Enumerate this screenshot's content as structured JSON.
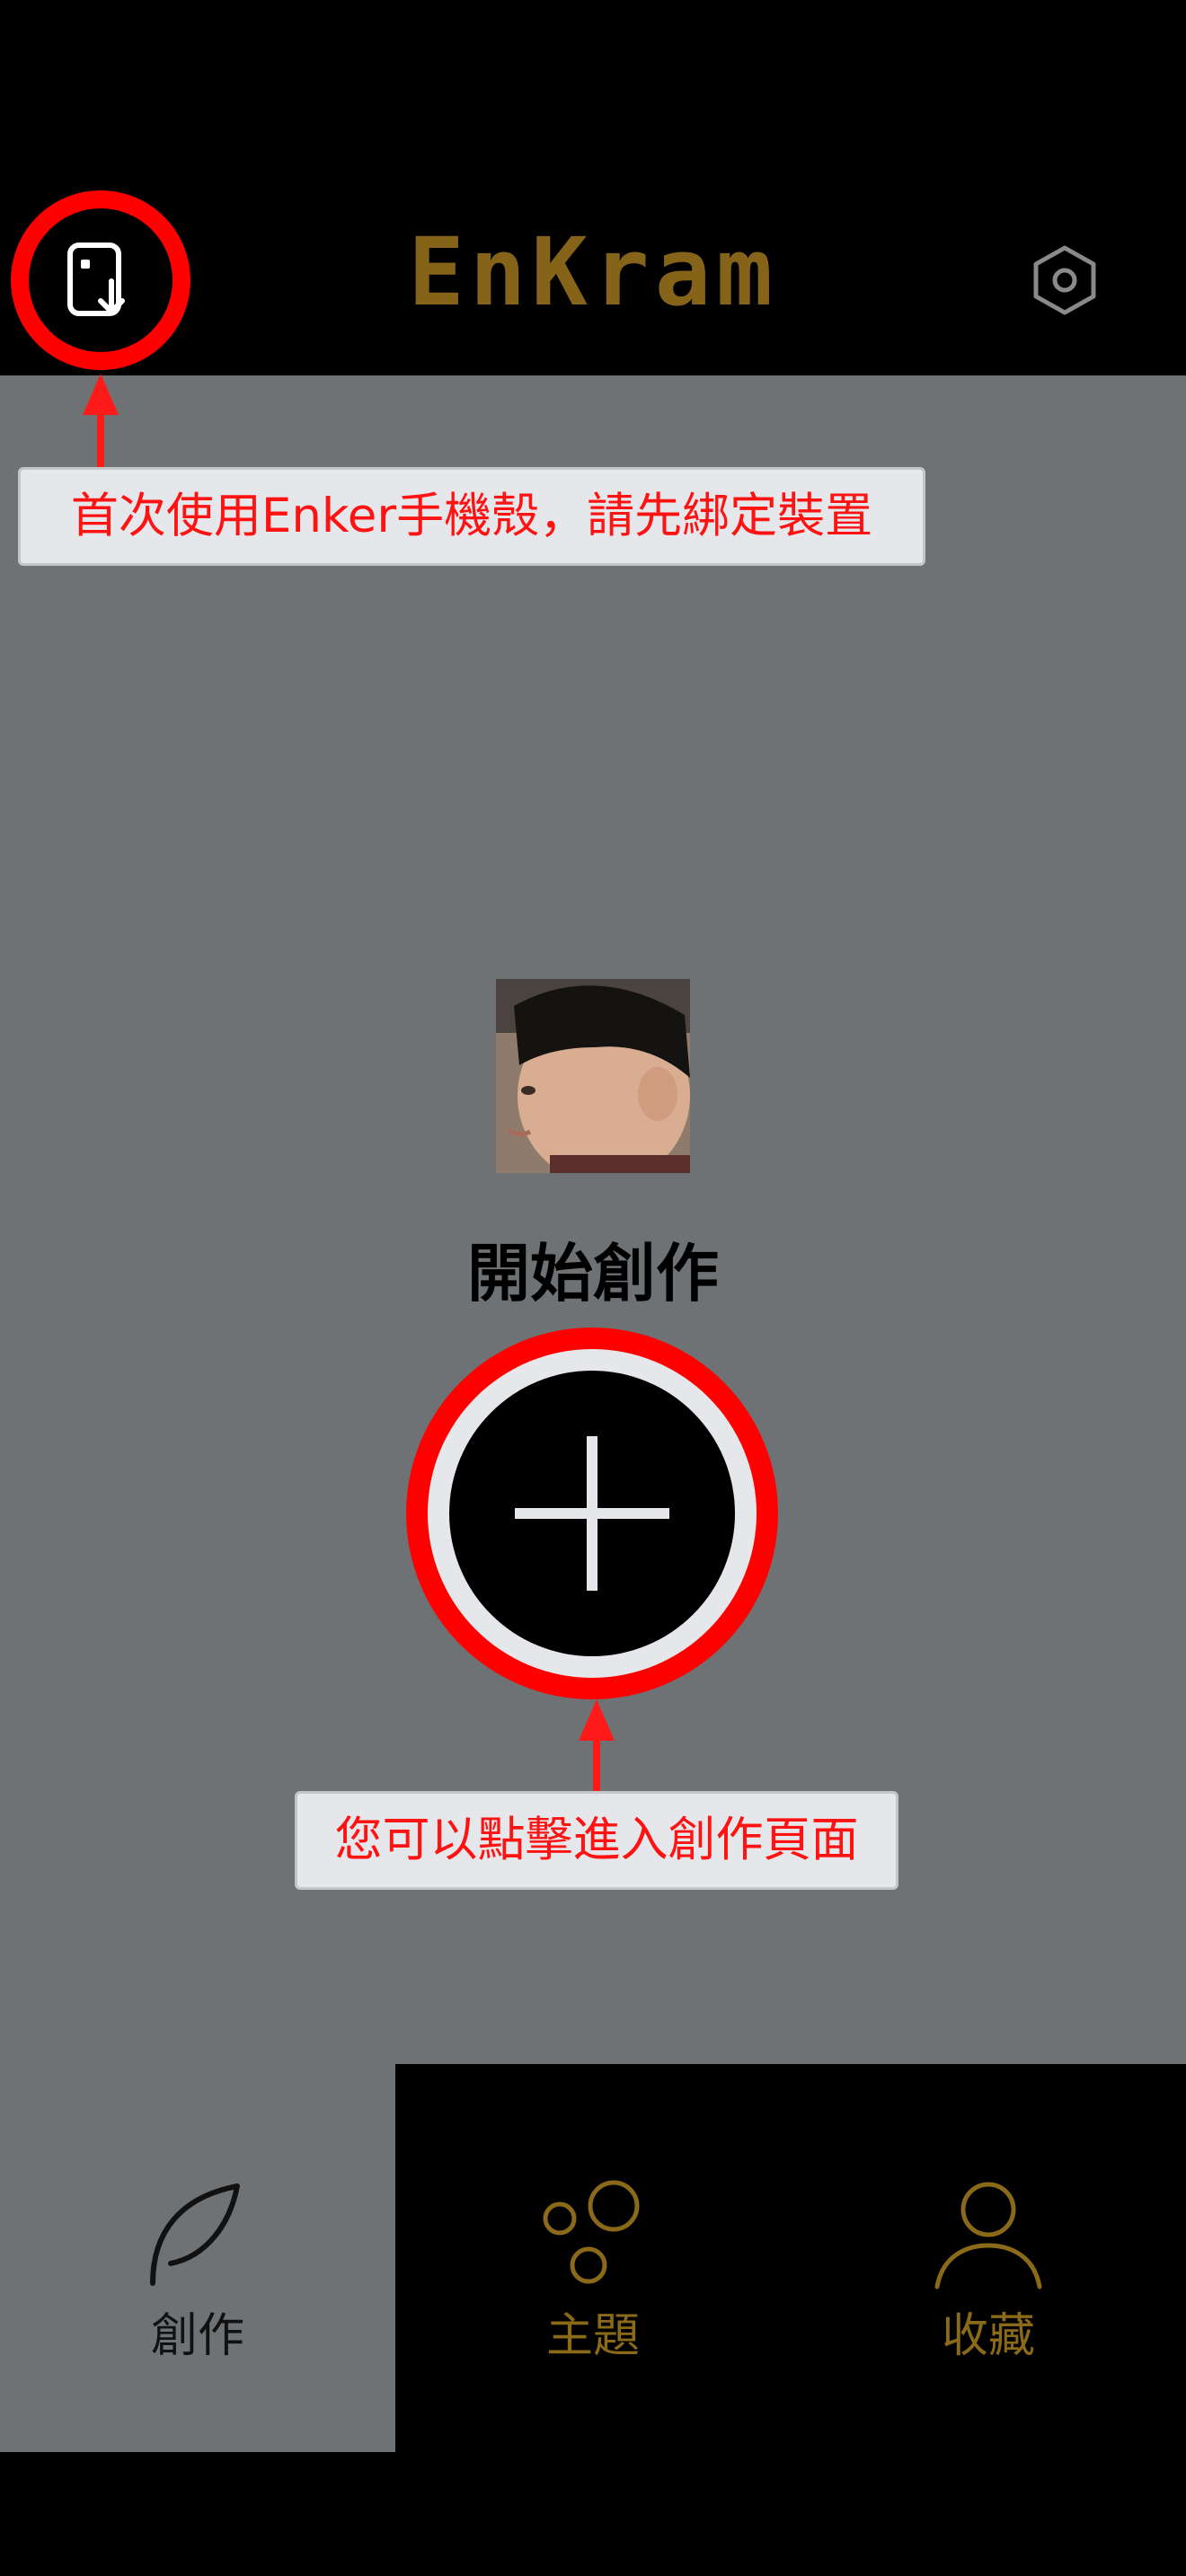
{
  "header": {
    "logo_text": "EnKram",
    "bind_icon": "phone-bind-icon",
    "settings_icon": "hexagon-gear-icon"
  },
  "tutorial": {
    "bind_tip": "首次使用Enker手機殼，請先綁定裝置",
    "create_tip": "您可以點擊進入創作頁面",
    "highlight_color": "#ff0000"
  },
  "main": {
    "start_title": "開始創作",
    "plus_icon": "plus-icon",
    "photo_icon": "profile-photo"
  },
  "tabs": [
    {
      "label": "創作",
      "icon": "leaf-icon",
      "active": true
    },
    {
      "label": "主題",
      "icon": "bubbles-icon",
      "active": false
    },
    {
      "label": "收藏",
      "icon": "user-icon",
      "active": false
    }
  ],
  "colors": {
    "accent_gold": "#856419",
    "background_gray": "#6f7275"
  }
}
